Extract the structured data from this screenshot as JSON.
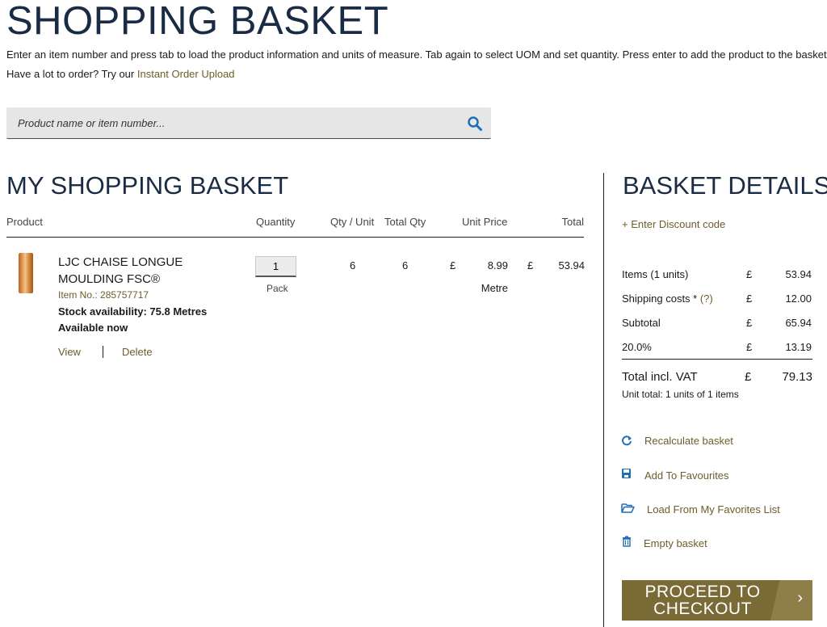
{
  "header": {
    "title": "SHOPPING BASKET",
    "intro": "Enter an item number and press tab to load the product information and units of measure. Tab again to select UOM and set quantity. Press enter to add the product to the basket.",
    "intro2_prefix": "Have a lot to order? Try our ",
    "intro2_link": "Instant Order Upload"
  },
  "search": {
    "placeholder": "Product name or item number...",
    "value": ""
  },
  "basket": {
    "title": "MY SHOPPING BASKET",
    "columns": {
      "product": "Product",
      "quantity": "Quantity",
      "qty_unit": "Qty / Unit",
      "total_qty": "Total Qty",
      "unit_price": "Unit Price",
      "total": "Total"
    },
    "item": {
      "name": "LJC CHAISE LONGUE MOULDING FSC®",
      "item_no": "Item No.: 285757717",
      "stock": "Stock availability: 75.8 Metres",
      "availability": "Available now",
      "view_label": "View",
      "delete_label": "Delete",
      "quantity": "1",
      "quantity_unit": "Pack",
      "qty_per_unit": "6",
      "total_qty": "6",
      "currency": "£",
      "unit_price": "8.99",
      "price_unit": "Metre",
      "total": "53.94"
    }
  },
  "details": {
    "title": "BASKET DETAILS",
    "discount_link": "+ Enter Discount code",
    "rows": [
      {
        "label": "Items (1 units)",
        "currency": "£",
        "value": "53.94"
      },
      {
        "label": "Shipping costs * ",
        "help": "(?)",
        "currency": "£",
        "value": "12.00"
      },
      {
        "label": "Subtotal",
        "currency": "£",
        "value": "65.94"
      },
      {
        "label": "20.0%",
        "currency": "£",
        "value": "13.19"
      }
    ],
    "total_label": "Total incl. VAT",
    "total_currency": "£",
    "total_value": "79.13",
    "unit_total": "Unit total: 1 units of 1 items",
    "actions": [
      {
        "label": "Recalculate basket",
        "icon": "refresh-icon"
      },
      {
        "label": "Add To Favourites",
        "icon": "save-icon"
      },
      {
        "label": "Load From My Favorites List",
        "icon": "folder-open-icon"
      },
      {
        "label": "Empty basket",
        "icon": "trash-icon"
      }
    ],
    "checkout_line1": "PROCEED TO",
    "checkout_line2": "CHECKOUT",
    "checkout_chevron": "›"
  },
  "colors": {
    "navy": "#1a2b44",
    "olive": "#6e5c2a",
    "button": "#7a6a35",
    "icon_blue": "#1f6fb5"
  }
}
